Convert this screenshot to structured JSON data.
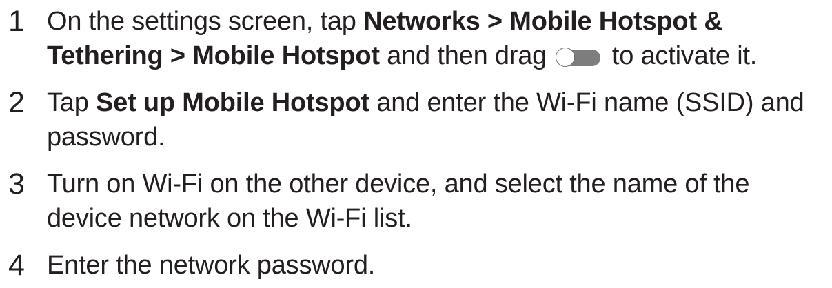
{
  "steps": [
    {
      "number": "1",
      "text_1": "On the settings screen, tap ",
      "bold_1": "Networks",
      "sep_1": " > ",
      "bold_2": "Mobile Hotspot & Tethering",
      "sep_2": " > ",
      "bold_3": "Mobile Hotspot",
      "text_2": " and then drag ",
      "text_3": " to activate it."
    },
    {
      "number": "2",
      "text_1": "Tap ",
      "bold_1": "Set up Mobile Hotspot",
      "text_2": " and enter the Wi-Fi name (SSID) and password."
    },
    {
      "number": "3",
      "text_1": "Turn on Wi-Fi on the other device, and select the name of the device network on the Wi-Fi list."
    },
    {
      "number": "4",
      "text_1": "Enter the network password."
    }
  ],
  "icons": {
    "toggle": "toggle-switch-off-icon"
  },
  "colors": {
    "text": "#231f20",
    "toggle_track": "#7d7d7d"
  }
}
